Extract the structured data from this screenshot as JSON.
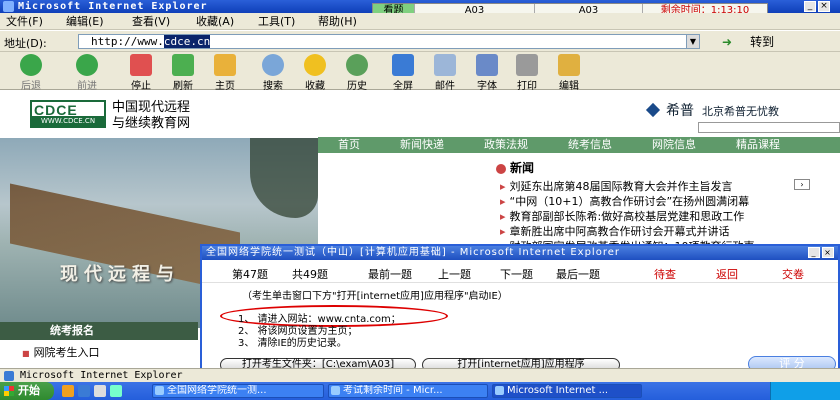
{
  "ie": {
    "title": "Microsoft Internet Explorer",
    "menu": [
      "文件(F)",
      "编辑(E)",
      "查看(V)",
      "收藏(A)",
      "工具(T)",
      "帮助(H)"
    ],
    "address_label": "地址(D):",
    "address_prefix": "http://www.",
    "address_selected": "cdce.cn",
    "go_label": "转到",
    "toolbar": [
      "后退",
      "前进",
      "停止",
      "刷新",
      "主页",
      "搜索",
      "收藏",
      "历史",
      "全屏",
      "邮件",
      "字体",
      "打印",
      "编辑"
    ]
  },
  "exam_bar": {
    "mode": "看题",
    "current_q": "A03",
    "q2": "A03",
    "time_label": "剩余时间：1:13:10"
  },
  "site": {
    "logo_big": "CDCE",
    "logo_small": "WWW.CDCE.CN",
    "name_line1": "中国现代远程",
    "name_line2": "与继续教育网",
    "partner_name": "希普",
    "partner_sub": "北京希普无忧教",
    "nav": [
      "首页",
      "新闻快递",
      "政策法规",
      "统考信息",
      "网院信息",
      "精品课程"
    ],
    "photo_text": "现代远程与",
    "news_title": "新闻",
    "news": [
      "刘延东出席第48届国际教育大会并作主旨发言",
      "“中网（10+1）高教合作研讨会”在扬州圆满闭幕",
      "教育部副部长陈希:做好高校基层党建和思政工作",
      "章新胜出席中阿高教合作研讨会开幕式并讲话",
      "财政部国家发展改革委发出通知：10项教育行政事"
    ],
    "reg_title": "统考报名",
    "reg_link": "网院考生入口"
  },
  "dialog": {
    "title": "全国网络学院统一测试（中山）[计算机应用基础] - Microsoft Internet Explorer",
    "q_no": "第47题",
    "q_total": "共49题",
    "nav": [
      "最前一题",
      "上一题",
      "下一题",
      "最后一题"
    ],
    "actions": [
      "待查",
      "返回",
      "交卷"
    ],
    "instruction": "（考生单击窗口下方\"打开[internet应用]应用程序\"启动IE）",
    "steps": [
      "1、 请进入网站：www.cnta.com；",
      "2、 将该网页设置为主页；",
      "3、 清除IE的历史记录。"
    ],
    "open_folder": "打开考生文件夹：[C:\\exam\\A03]",
    "open_app": "打开[internet应用]应用程序",
    "eval": "评 分"
  },
  "status_text": "Microsoft Internet Explorer",
  "taskbar": {
    "start": "开始",
    "tasks": [
      "全国网络学院统一测...",
      "考试剩余时间 - Micr...",
      "Microsoft Internet ..."
    ]
  },
  "colors": {
    "accent_red": "#dd0000",
    "title_blue": "#2a5fd8",
    "nav_green": "#5f9a6a"
  }
}
